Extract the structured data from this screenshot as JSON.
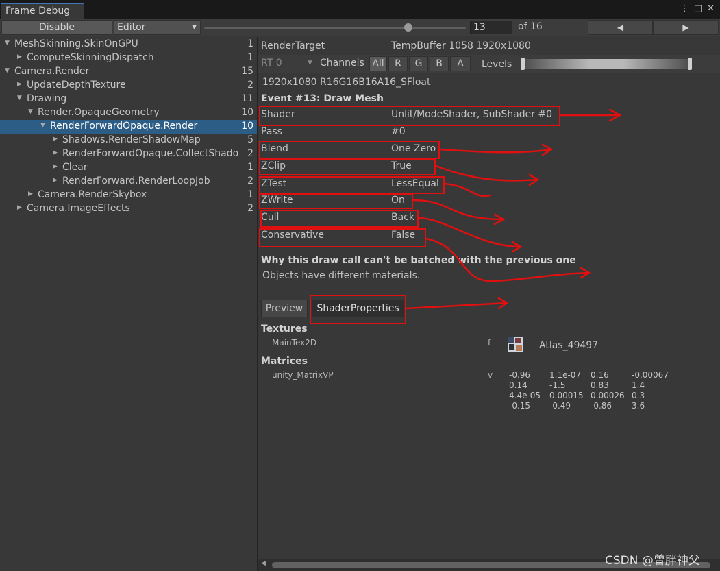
{
  "window": {
    "tab_title": "Frame Debug"
  },
  "toolbar": {
    "disable_label": "Disable",
    "target_label": "Editor",
    "frame_value": "13",
    "frame_total": "of 16",
    "prev_icon": "◀",
    "next_icon": "▶",
    "slider_fraction": 0.78
  },
  "tree": [
    {
      "label": "MeshSkinning.SkinOnGPU",
      "count": "1",
      "expanded": true
    },
    {
      "label": "ComputeSkinningDispatch",
      "count": "1",
      "expanded": false
    },
    {
      "label": "Camera.Render",
      "count": "15",
      "expanded": true
    },
    {
      "label": "UpdateDepthTexture",
      "count": "2",
      "expanded": false
    },
    {
      "label": "Drawing",
      "count": "11",
      "expanded": true
    },
    {
      "label": "Render.OpaqueGeometry",
      "count": "10",
      "expanded": true
    },
    {
      "label": "RenderForwardOpaque.Render",
      "count": "10",
      "expanded": true,
      "selected": true
    },
    {
      "label": "Shadows.RenderShadowMap",
      "count": "5",
      "expanded": false
    },
    {
      "label": "RenderForwardOpaque.CollectShado",
      "count": "2",
      "expanded": false
    },
    {
      "label": "Clear",
      "count": "1",
      "expanded": false
    },
    {
      "label": "RenderForward.RenderLoopJob",
      "count": "2",
      "expanded": false
    },
    {
      "label": "Camera.RenderSkybox",
      "count": "1",
      "expanded": false
    },
    {
      "label": "Camera.ImageEffects",
      "count": "2",
      "expanded": false
    }
  ],
  "details": {
    "render_target_label": "RenderTarget",
    "render_target_value": "TempBuffer 1058 1920x1080",
    "rt_dropdown": "RT 0",
    "channels_label": "Channels",
    "channels": [
      "All",
      "R",
      "G",
      "B",
      "A"
    ],
    "levels_label": "Levels",
    "format": "1920x1080 R16G16B16A16_SFloat",
    "event_title": "Event #13: Draw Mesh",
    "props": [
      {
        "key": "Shader",
        "value": "Unlit/ModeShader, SubShader #0"
      },
      {
        "key": "Pass",
        "value": "#0"
      },
      {
        "key": "Blend",
        "value": "One Zero"
      },
      {
        "key": "ZClip",
        "value": "True"
      },
      {
        "key": "ZTest",
        "value": "LessEqual"
      },
      {
        "key": "ZWrite",
        "value": "On"
      },
      {
        "key": "Cull",
        "value": "Back"
      },
      {
        "key": "Conservative",
        "value": "False"
      }
    ],
    "batch_title": "Why this draw call can't be batched with the previous one",
    "batch_reason": "Objects have different materials.",
    "tab_preview": "Preview",
    "tab_shader_props": "ShaderProperties",
    "textures_title": "Textures",
    "texture_name": "MainTex2D",
    "texture_stage": "f",
    "texture_value": "Atlas_49497",
    "matrices_title": "Matrices",
    "matrix_name": "unity_MatrixVP",
    "matrix_stage": "v",
    "matrix_rows": [
      [
        "-0.96",
        "1.1e-07",
        "0.16",
        "-0.00067"
      ],
      [
        "0.14",
        "-1.5",
        "0.83",
        "1.4"
      ],
      [
        "4.4e-05",
        "0.00015",
        "0.00026",
        "0.3"
      ],
      [
        "-0.15",
        "-0.49",
        "-0.86",
        "3.6"
      ]
    ]
  },
  "watermark": "CSDN @曾胖神父",
  "colors": {
    "annotation_red": "#e01010",
    "selection_blue": "#2c5d87",
    "tab_accent": "#3a79bb"
  }
}
